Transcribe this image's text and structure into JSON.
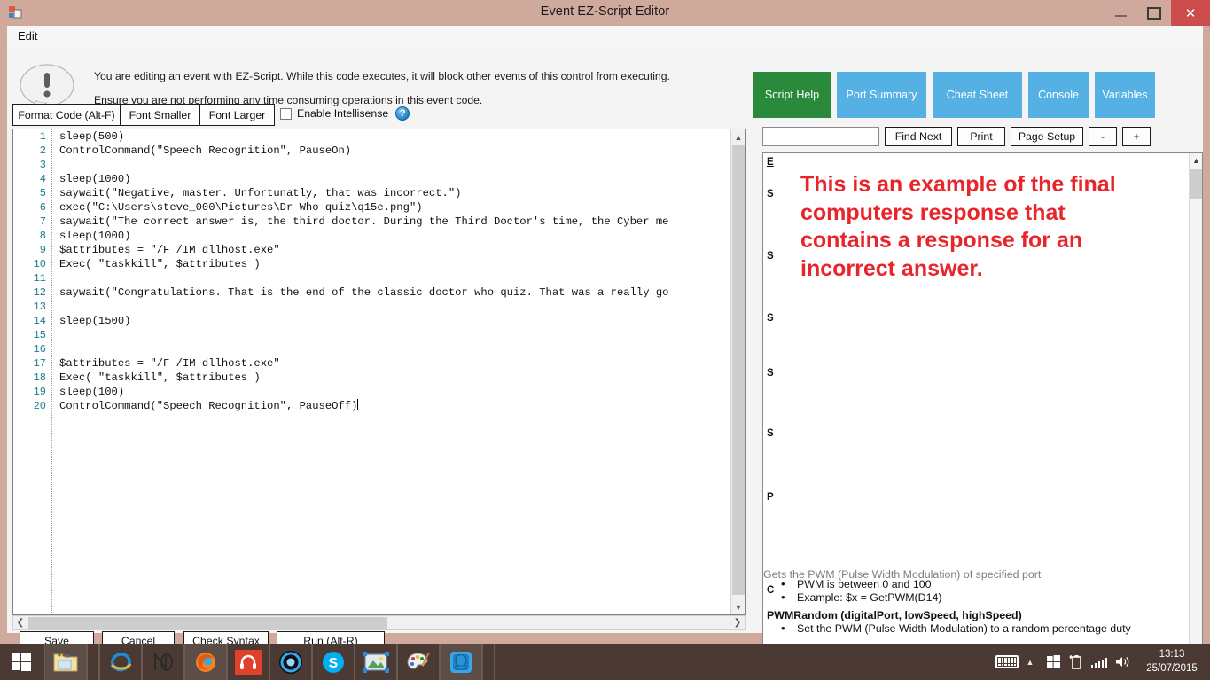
{
  "window": {
    "title": "Event EZ-Script Editor",
    "icon": "app-icon",
    "minimize": "minimize",
    "maximize": "maximize",
    "close": "✕"
  },
  "menubar": {
    "edit": "Edit"
  },
  "warning": {
    "icon": "warning-exclamation-icon",
    "line1": "You are editing an event with EZ-Script. While this code executes, it will block other events of this control from executing.",
    "line2": "Ensure you are not performing any time consuming operations in this event code."
  },
  "toolbar": {
    "format_code": "Format Code (Alt-F)",
    "font_smaller": "Font Smaller",
    "font_larger": "Font Larger",
    "intellisense_label": "Enable Intellisense",
    "intellisense_checked": false,
    "help_glyph": "?"
  },
  "editor": {
    "line_numbers": [
      1,
      2,
      3,
      4,
      5,
      6,
      7,
      8,
      9,
      10,
      11,
      12,
      13,
      14,
      15,
      16,
      17,
      18,
      19,
      20
    ],
    "lines": [
      "sleep(500)",
      "ControlCommand(\"Speech Recognition\", PauseOn)",
      "",
      "sleep(1000)",
      "saywait(\"Negative, master. Unfortunatly, that was incorrect.\")",
      "exec(\"C:\\Users\\steve_000\\Pictures\\Dr Who quiz\\q15e.png\")",
      "saywait(\"The correct answer is, the third doctor. During the Third Doctor's time, the Cyber me",
      "sleep(1000)",
      "$attributes = \"/F /IM dllhost.exe\"",
      "Exec( \"taskkill\", $attributes )",
      "",
      "saywait(\"Congratulations. That is the end of the classic doctor who quiz. That was a really go",
      "",
      "sleep(1500)",
      "",
      "",
      "$attributes = \"/F /IM dllhost.exe\"",
      "Exec( \"taskkill\", $attributes )",
      "sleep(100)",
      "ControlCommand(\"Speech Recognition\", PauseOff)"
    ],
    "caret_line": 20
  },
  "actions": {
    "save": "Save",
    "cancel": "Cancel",
    "check_syntax": "Check Syntax",
    "run": "Run (Alt-R)"
  },
  "right_panel": {
    "tabs": [
      {
        "label": "Script Help",
        "active": true
      },
      {
        "label": "Port Summary",
        "active": false
      },
      {
        "label": "Cheat Sheet",
        "active": false
      },
      {
        "label": "Console",
        "active": false
      },
      {
        "label": "Variables",
        "active": false
      }
    ],
    "find": {
      "value": "",
      "placeholder": "",
      "find_next": "Find Next",
      "print": "Print",
      "page_setup": "Page Setup",
      "zoom_out": "-",
      "zoom_in": "+"
    },
    "annotation": "This is an example of the final computers response that contains a response for an incorrect answer.",
    "annotation_color": "#e8252b",
    "clipped_headings": [
      "E",
      "S",
      "S",
      "S",
      "S",
      "S",
      "P",
      "C"
    ],
    "help_content": {
      "clipped_line": "Gets the PWM (Pulse Width Modulation) of specified port",
      "bullets": [
        "PWM is between 0 and 100",
        "Example: $x = GetPWM(D14)"
      ],
      "next_heading": "PWMRandom (digitalPort, lowSpeed, highSpeed)",
      "next_bullet": "Set the PWM (Pulse Width Modulation) to a random percentage duty"
    }
  },
  "taskbar": {
    "start": "start-button",
    "items": [
      {
        "name": "file-explorer",
        "icon": "folder-icon"
      },
      {
        "name": "internet-explorer",
        "icon": "ie-icon"
      },
      {
        "name": "notepad-plus",
        "icon": "np-icon"
      },
      {
        "name": "firefox",
        "icon": "firefox-icon"
      },
      {
        "name": "headphones-app",
        "icon": "headphones-icon"
      },
      {
        "name": "ez-builder",
        "icon": "blue-circle-icon"
      },
      {
        "name": "skype",
        "icon": "skype-icon"
      },
      {
        "name": "photo-viewer",
        "icon": "photo-icon"
      },
      {
        "name": "paint",
        "icon": "paint-palette-icon"
      },
      {
        "name": "robot-app",
        "icon": "robot-head-icon"
      }
    ],
    "tray": {
      "keyboard": "touch-keyboard-icon",
      "show_hidden": "▲",
      "windows": "windows-flag-icon",
      "battery": "battery-icon",
      "network": "signal-bars-icon",
      "volume": "speaker-icon",
      "time": "13:13",
      "date": "25/07/2015"
    }
  },
  "colors": {
    "title_bar": "#cfa99c",
    "tab_inactive": "#55b0e4",
    "tab_active": "#2a8a3c",
    "annotation_red": "#e8252b",
    "line_number": "#1c7d8c",
    "taskbar": "#4a3a33"
  }
}
